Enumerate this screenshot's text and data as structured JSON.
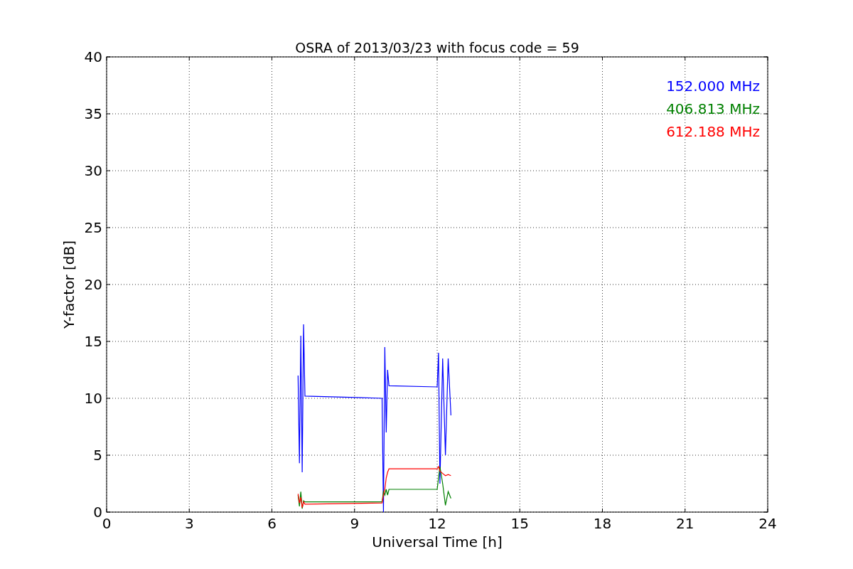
{
  "figure": {
    "chart_data": {
      "type": "line",
      "title": "OSRA of 2013/03/23 with focus code = 59",
      "xlabel": "Universal Time [h]",
      "ylabel": "Y-factor [dB]",
      "xlim": [
        0,
        24
      ],
      "ylim": [
        0,
        40
      ],
      "xticks": [
        0,
        3,
        6,
        9,
        12,
        15,
        18,
        21,
        24
      ],
      "yticks": [
        0,
        5,
        10,
        15,
        20,
        25,
        30,
        35,
        40
      ],
      "grid": true,
      "x": [
        6.95,
        7.0,
        7.05,
        7.1,
        7.15,
        7.2,
        10.0,
        10.05,
        10.1,
        10.15,
        10.2,
        10.25,
        12.0,
        12.05,
        12.1,
        12.2,
        12.3,
        12.4,
        12.5
      ],
      "series": [
        {
          "name": "152.000 MHz",
          "color": "#0000ff",
          "values": [
            12,
            4.3,
            15.5,
            3.5,
            16.5,
            10.2,
            10.0,
            0,
            14.5,
            7,
            12.5,
            11.1,
            11.0,
            14,
            2.5,
            13.5,
            5,
            13.5,
            8.5
          ]
        },
        {
          "name": "406.813 MHz",
          "color": "#008000",
          "values": [
            1.5,
            0.5,
            1.8,
            0.3,
            1.0,
            0.9,
            0.9,
            1.8,
            1.5,
            2.0,
            1.5,
            2.0,
            2.0,
            3.0,
            4.0,
            2.5,
            0.6,
            1.8,
            1.2
          ]
        },
        {
          "name": "612.188 MHz",
          "color": "#ff0000",
          "values": [
            1.6,
            0.8,
            1.3,
            0.4,
            0.9,
            0.7,
            0.8,
            1.5,
            2.0,
            3.0,
            3.5,
            3.8,
            3.8,
            4.0,
            3.6,
            3.4,
            3.2,
            3.3,
            3.2
          ]
        }
      ]
    }
  }
}
